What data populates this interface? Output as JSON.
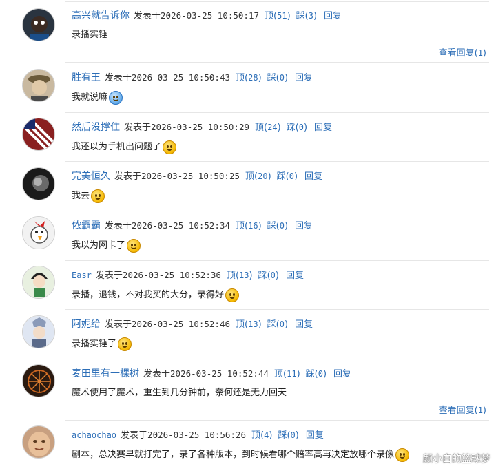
{
  "labels": {
    "posted": "发表于",
    "up": "顶",
    "down": "踩",
    "reply": "回复",
    "view_replies": "查看回复"
  },
  "comments": [
    {
      "user": "高兴就告诉你",
      "time": "2026-03-25 10:50:17",
      "up": "51",
      "down": "3",
      "text": "录播实锤",
      "emoji": "",
      "replies": "1"
    },
    {
      "user": "胜有王",
      "time": "2026-03-25 10:50:43",
      "up": "28",
      "down": "0",
      "text": "我就说嘛",
      "emoji": "crying-face-emoji"
    },
    {
      "user": "然后没撑住",
      "time": "2026-03-25 10:50:29",
      "up": "24",
      "down": "0",
      "text": "我还以为手机出问题了",
      "emoji": "cat-face-emoji"
    },
    {
      "user": "完美恒久",
      "time": "2026-03-25 10:50:25",
      "up": "20",
      "down": "0",
      "text": "我去",
      "emoji": "shocked-face-emoji"
    },
    {
      "user": "侬霸霸",
      "time": "2026-03-25 10:52:34",
      "up": "16",
      "down": "0",
      "text": "我以为网卡了",
      "emoji": "laughing-face-emoji"
    },
    {
      "user": "Easr",
      "time": "2026-03-25 10:52:36",
      "up": "13",
      "down": "0",
      "text": "录播，退钱，不对我买的大分，录得好",
      "emoji": "grinning-face-emoji"
    },
    {
      "user": "阿妮给",
      "time": "2026-03-25 10:52:46",
      "up": "13",
      "down": "0",
      "text": "录播实锤了",
      "emoji": "sweat-face-emoji"
    },
    {
      "user": "麦田里有一棵树",
      "time": "2026-03-25 10:52:44",
      "up": "11",
      "down": "0",
      "text": "魔术使用了魔术，重生到几分钟前，奈何还是无力回天",
      "emoji": "",
      "replies": "1"
    },
    {
      "user": "achaochao",
      "time": "2026-03-25 10:56:26",
      "up": "4",
      "down": "0",
      "text": "剧本，总决赛早就打完了，录了各种版本，到时候看哪个赔率高再决定放哪个录像",
      "emoji": "smile-face-emoji"
    }
  ],
  "watermark": "颜小白的篮球梦",
  "colors": {
    "link": "#2c6eb7",
    "divider": "#e6e6e6",
    "text": "#222222"
  }
}
